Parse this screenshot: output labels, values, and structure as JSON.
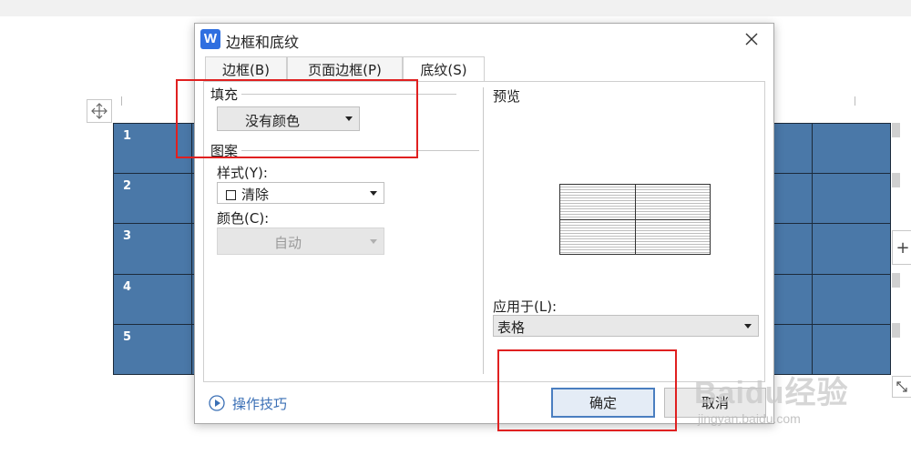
{
  "document": {
    "row_numbers": [
      "1",
      "2",
      "3",
      "4",
      "5"
    ],
    "add_row_symbol": "+",
    "table_fill_color": "#4a78a8"
  },
  "dialog": {
    "app_logo_letter": "W",
    "title": "边框和底纹",
    "tabs": [
      {
        "label": "边框(B)",
        "active": false
      },
      {
        "label": "页面边框(P)",
        "active": false
      },
      {
        "label": "底纹(S)",
        "active": true
      }
    ],
    "fill": {
      "section_label": "填充",
      "color_value": "没有颜色"
    },
    "pattern": {
      "section_label": "图案",
      "style_label": "样式(Y):",
      "style_value": "清除",
      "color_label": "颜色(C):",
      "color_value": "自动"
    },
    "preview": {
      "label": "预览"
    },
    "apply_to": {
      "label": "应用于(L):",
      "value": "表格"
    },
    "footer": {
      "tips_link": "操作技巧",
      "ok_label": "确定",
      "cancel_label": "取消"
    }
  },
  "watermark": {
    "brand": "Baidu经验",
    "url": "jingyan.baidu.com"
  },
  "accent_colors": {
    "annotation_red": "#e02020",
    "link_blue": "#3a6fb5",
    "ok_border": "#4a7ec0"
  }
}
